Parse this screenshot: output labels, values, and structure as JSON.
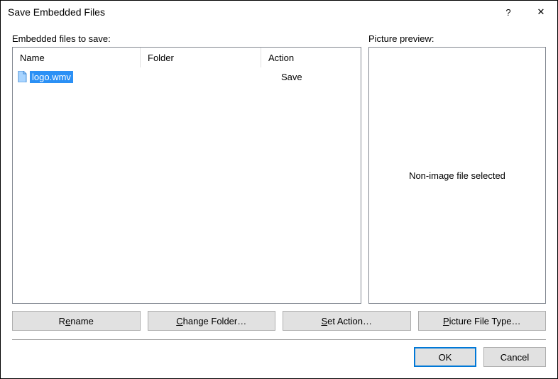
{
  "titlebar": {
    "title": "Save Embedded Files",
    "help": "?",
    "close": "✕"
  },
  "labels": {
    "embedded_files": "Embedded files to save:",
    "picture_preview": "Picture preview:"
  },
  "columns": {
    "name": "Name",
    "folder": "Folder",
    "action": "Action"
  },
  "rows": [
    {
      "filename": "logo.wmv",
      "folder": "",
      "action": "Save"
    }
  ],
  "preview_text": "Non-image file selected",
  "buttons": {
    "rename_pre": "R",
    "rename_ul": "e",
    "rename_post": "name",
    "change_pre": "",
    "change_ul": "C",
    "change_post": "hange Folder…",
    "setaction_pre": "",
    "setaction_ul": "S",
    "setaction_post": "et Action…",
    "pictype_pre": "",
    "pictype_ul": "P",
    "pictype_post": "icture File Type…"
  },
  "footer": {
    "ok": "OK",
    "cancel": "Cancel"
  }
}
